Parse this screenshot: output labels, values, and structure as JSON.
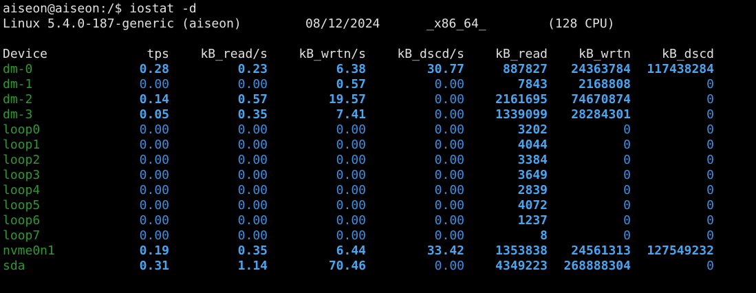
{
  "colors": {
    "background": "#000000",
    "text": "#e0e0e0",
    "device_name": "#2e9a2e",
    "value_nonzero": "#4aa6f0",
    "value_zero": "#3b8ee0"
  },
  "terminal": {
    "prompt": "aiseon@aiseon:/$ iostat -d",
    "sysinfo": {
      "kernel": "Linux 5.4.0-187-generic (aiseon)",
      "date": "08/12/2024",
      "arch": "_x86_64_",
      "cpu": "(128 CPU)"
    },
    "headers": [
      "Device",
      "tps",
      "kB_read/s",
      "kB_wrtn/s",
      "kB_dscd/s",
      "kB_read",
      "kB_wrtn",
      "kB_dscd"
    ],
    "rows": [
      {
        "device": "dm-0",
        "tps": "0.28",
        "kb_read_s": "0.23",
        "kb_wrtn_s": "6.38",
        "kb_dscd_s": "30.77",
        "kb_read": "887827",
        "kb_wrtn": "24363784",
        "kb_dscd": "117438284"
      },
      {
        "device": "dm-1",
        "tps": "0.00",
        "kb_read_s": "0.00",
        "kb_wrtn_s": "0.57",
        "kb_dscd_s": "0.00",
        "kb_read": "7843",
        "kb_wrtn": "2168808",
        "kb_dscd": "0"
      },
      {
        "device": "dm-2",
        "tps": "0.14",
        "kb_read_s": "0.57",
        "kb_wrtn_s": "19.57",
        "kb_dscd_s": "0.00",
        "kb_read": "2161695",
        "kb_wrtn": "74670874",
        "kb_dscd": "0"
      },
      {
        "device": "dm-3",
        "tps": "0.05",
        "kb_read_s": "0.35",
        "kb_wrtn_s": "7.41",
        "kb_dscd_s": "0.00",
        "kb_read": "1339099",
        "kb_wrtn": "28284301",
        "kb_dscd": "0"
      },
      {
        "device": "loop0",
        "tps": "0.00",
        "kb_read_s": "0.00",
        "kb_wrtn_s": "0.00",
        "kb_dscd_s": "0.00",
        "kb_read": "3202",
        "kb_wrtn": "0",
        "kb_dscd": "0"
      },
      {
        "device": "loop1",
        "tps": "0.00",
        "kb_read_s": "0.00",
        "kb_wrtn_s": "0.00",
        "kb_dscd_s": "0.00",
        "kb_read": "4044",
        "kb_wrtn": "0",
        "kb_dscd": "0"
      },
      {
        "device": "loop2",
        "tps": "0.00",
        "kb_read_s": "0.00",
        "kb_wrtn_s": "0.00",
        "kb_dscd_s": "0.00",
        "kb_read": "3384",
        "kb_wrtn": "0",
        "kb_dscd": "0"
      },
      {
        "device": "loop3",
        "tps": "0.00",
        "kb_read_s": "0.00",
        "kb_wrtn_s": "0.00",
        "kb_dscd_s": "0.00",
        "kb_read": "3649",
        "kb_wrtn": "0",
        "kb_dscd": "0"
      },
      {
        "device": "loop4",
        "tps": "0.00",
        "kb_read_s": "0.00",
        "kb_wrtn_s": "0.00",
        "kb_dscd_s": "0.00",
        "kb_read": "2839",
        "kb_wrtn": "0",
        "kb_dscd": "0"
      },
      {
        "device": "loop5",
        "tps": "0.00",
        "kb_read_s": "0.00",
        "kb_wrtn_s": "0.00",
        "kb_dscd_s": "0.00",
        "kb_read": "4072",
        "kb_wrtn": "0",
        "kb_dscd": "0"
      },
      {
        "device": "loop6",
        "tps": "0.00",
        "kb_read_s": "0.00",
        "kb_wrtn_s": "0.00",
        "kb_dscd_s": "0.00",
        "kb_read": "1237",
        "kb_wrtn": "0",
        "kb_dscd": "0"
      },
      {
        "device": "loop7",
        "tps": "0.00",
        "kb_read_s": "0.00",
        "kb_wrtn_s": "0.00",
        "kb_dscd_s": "0.00",
        "kb_read": "8",
        "kb_wrtn": "0",
        "kb_dscd": "0"
      },
      {
        "device": "nvme0n1",
        "tps": "0.19",
        "kb_read_s": "0.35",
        "kb_wrtn_s": "6.44",
        "kb_dscd_s": "33.42",
        "kb_read": "1353838",
        "kb_wrtn": "24561313",
        "kb_dscd": "127549232"
      },
      {
        "device": "sda",
        "tps": "0.31",
        "kb_read_s": "1.14",
        "kb_wrtn_s": "70.46",
        "kb_dscd_s": "0.00",
        "kb_read": "4349223",
        "kb_wrtn": "268888304",
        "kb_dscd": "0"
      }
    ]
  }
}
